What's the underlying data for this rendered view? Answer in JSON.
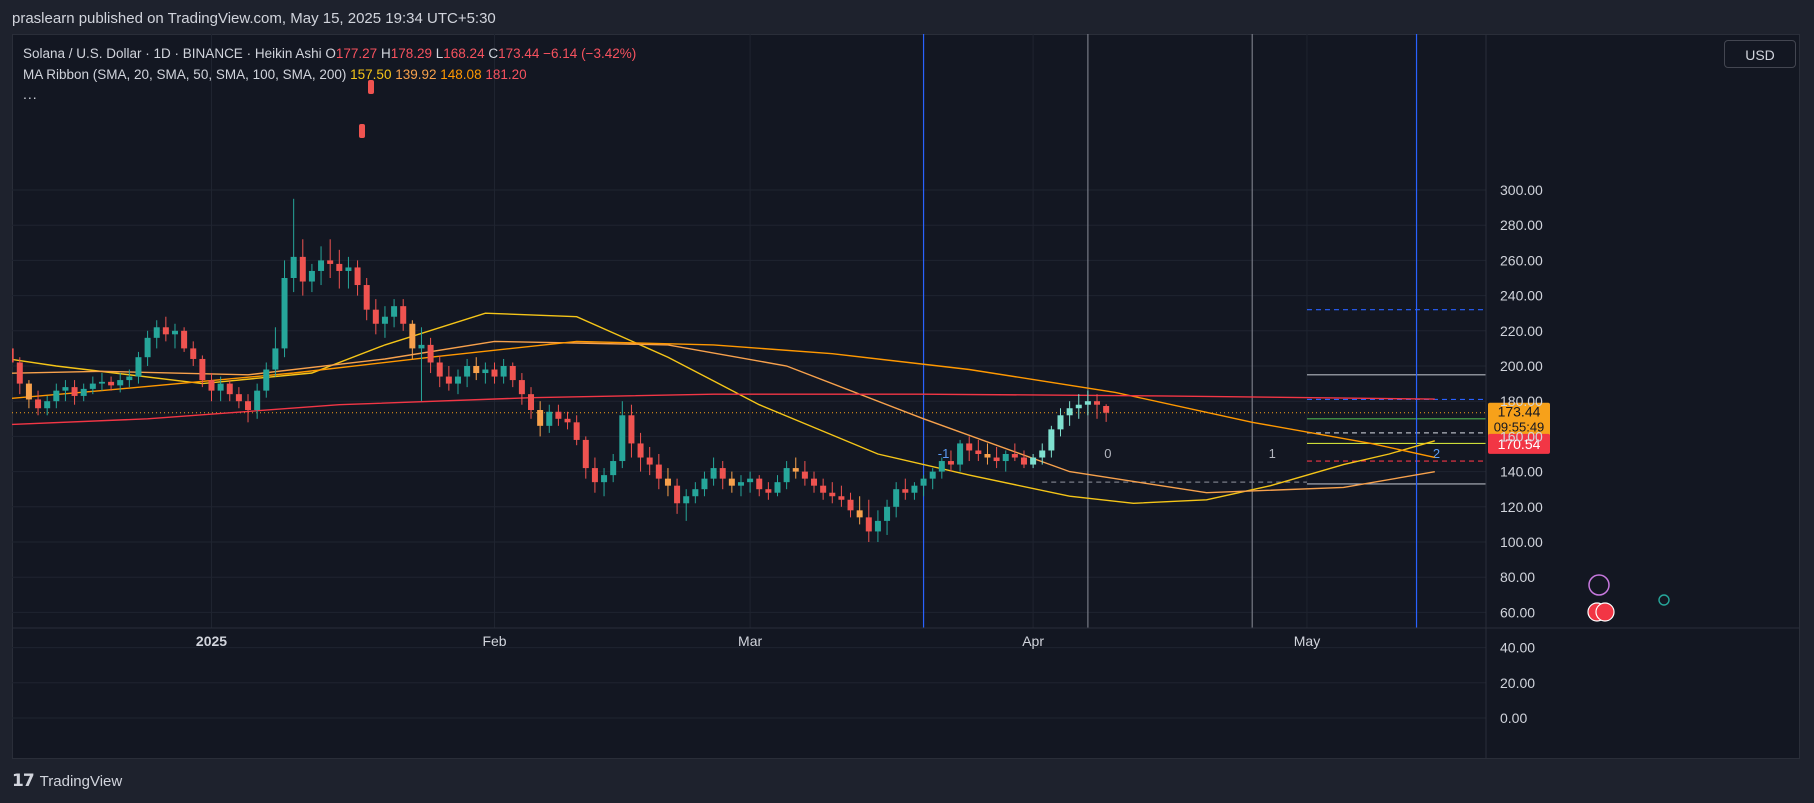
{
  "header": {
    "published": "praslearn published on TradingView.com, May 15, 2025 19:34 UTC+5:30"
  },
  "legend": {
    "symbol": "Solana / U.S. Dollar · 1D · BINANCE · Heikin Ashi",
    "o_label": "O",
    "o_value": "177.27",
    "h_label": "H",
    "h_value": "178.29",
    "l_label": "L",
    "l_value": "168.24",
    "c_label": "C",
    "c_value": "173.44",
    "change": "−6.14 (−3.42%)",
    "ma_label": "MA Ribbon (SMA, 20, SMA, 50, SMA, 100, SMA, 200)",
    "ma20": "157.50",
    "ma50": "139.92",
    "ma100": "148.08",
    "ma200": "181.20",
    "more": "..."
  },
  "currency": "USD",
  "price_badges": {
    "last": "173.44",
    "countdown": "09:55:49",
    "marker": "170.54"
  },
  "cycle_labels": [
    "-1",
    "0",
    "1",
    "2"
  ],
  "footer": {
    "brand": "TradingView"
  },
  "colors": {
    "up": "#26a69a",
    "down": "#ef5350",
    "ma20": "#f5c518",
    "ma50": "#f7a14c",
    "ma100": "#ff9800",
    "ma200": "#f23645",
    "cycle": "#2962ff",
    "badge_last": "#f7a11a",
    "badge_marker": "#f23645"
  },
  "chart_data": {
    "type": "candlestick",
    "x_ticks": [
      {
        "label": "2025",
        "date": "2025-01-01"
      },
      {
        "label": "Feb",
        "date": "2025-02-01"
      },
      {
        "label": "Mar",
        "date": "2025-03-01"
      },
      {
        "label": "Apr",
        "date": "2025-04-01"
      },
      {
        "label": "May",
        "date": "2025-05-01"
      }
    ],
    "y_ticks": [
      0,
      20,
      40,
      60,
      80,
      100,
      120,
      140,
      160,
      180,
      200,
      220,
      240,
      260,
      280,
      300
    ],
    "ylim": [
      0,
      300
    ],
    "candles_start": "2024-12-02",
    "candles": [
      [
        210,
        220,
        200,
        195
      ],
      [
        205,
        226,
        200,
        213
      ],
      [
        213,
        230,
        208,
        222
      ],
      [
        222,
        226,
        212,
        220
      ],
      [
        220,
        224,
        212,
        216
      ],
      [
        216,
        222,
        208,
        213
      ],
      [
        213,
        220,
        206,
        216
      ],
      [
        216,
        220,
        204,
        210
      ],
      [
        210,
        214,
        196,
        202
      ],
      [
        202,
        205,
        184,
        190
      ],
      [
        190,
        192,
        176,
        181
      ],
      [
        181,
        186,
        172,
        176
      ],
      [
        176,
        183,
        172,
        180
      ],
      [
        180,
        190,
        176,
        186
      ],
      [
        186,
        192,
        180,
        188
      ],
      [
        188,
        192,
        178,
        183
      ],
      [
        183,
        190,
        180,
        187
      ],
      [
        187,
        194,
        184,
        190
      ],
      [
        190,
        196,
        186,
        191
      ],
      [
        191,
        194,
        186,
        189
      ],
      [
        189,
        196,
        185,
        192
      ],
      [
        192,
        198,
        188,
        194
      ],
      [
        194,
        208,
        190,
        205
      ],
      [
        205,
        220,
        200,
        216
      ],
      [
        216,
        226,
        210,
        222
      ],
      [
        222,
        228,
        214,
        218
      ],
      [
        218,
        224,
        210,
        220
      ],
      [
        220,
        222,
        208,
        210
      ],
      [
        210,
        214,
        200,
        204
      ],
      [
        204,
        206,
        188,
        192
      ],
      [
        192,
        196,
        180,
        186
      ],
      [
        186,
        194,
        180,
        190
      ],
      [
        190,
        192,
        180,
        184
      ],
      [
        184,
        188,
        176,
        180
      ],
      [
        180,
        184,
        168,
        175
      ],
      [
        175,
        190,
        170,
        186
      ],
      [
        186,
        202,
        182,
        198
      ],
      [
        198,
        222,
        194,
        210
      ],
      [
        210,
        260,
        205,
        250
      ],
      [
        250,
        295,
        242,
        262
      ],
      [
        262,
        272,
        240,
        248
      ],
      [
        248,
        258,
        242,
        254
      ],
      [
        254,
        268,
        246,
        260
      ],
      [
        260,
        272,
        250,
        258
      ],
      [
        258,
        266,
        244,
        254
      ],
      [
        254,
        262,
        244,
        256
      ],
      [
        256,
        260,
        240,
        246
      ],
      [
        246,
        250,
        226,
        232
      ],
      [
        232,
        238,
        218,
        224
      ],
      [
        224,
        234,
        216,
        228
      ],
      [
        228,
        238,
        222,
        234
      ],
      [
        234,
        238,
        220,
        224
      ],
      [
        224,
        226,
        204,
        210
      ],
      [
        210,
        222,
        180,
        212
      ],
      [
        212,
        216,
        196,
        202
      ],
      [
        202,
        206,
        188,
        194
      ],
      [
        194,
        200,
        186,
        190
      ],
      [
        190,
        198,
        184,
        194
      ],
      [
        194,
        204,
        188,
        200
      ],
      [
        200,
        205,
        192,
        196
      ],
      [
        196,
        202,
        190,
        198
      ],
      [
        198,
        202,
        190,
        194
      ],
      [
        194,
        204,
        190,
        200
      ],
      [
        200,
        202,
        188,
        192
      ],
      [
        192,
        196,
        178,
        184
      ],
      [
        184,
        188,
        170,
        175
      ],
      [
        175,
        180,
        160,
        166
      ],
      [
        166,
        178,
        162,
        174
      ],
      [
        174,
        178,
        166,
        170
      ],
      [
        170,
        174,
        164,
        168
      ],
      [
        168,
        172,
        155,
        158
      ],
      [
        158,
        160,
        136,
        142
      ],
      [
        142,
        148,
        128,
        134
      ],
      [
        134,
        142,
        126,
        138
      ],
      [
        138,
        150,
        134,
        146
      ],
      [
        146,
        180,
        142,
        172
      ],
      [
        172,
        178,
        148,
        156
      ],
      [
        156,
        162,
        140,
        148
      ],
      [
        148,
        154,
        138,
        144
      ],
      [
        144,
        150,
        130,
        136
      ],
      [
        136,
        142,
        126,
        132
      ],
      [
        132,
        136,
        116,
        122
      ],
      [
        122,
        130,
        112,
        126
      ],
      [
        126,
        134,
        122,
        130
      ],
      [
        130,
        140,
        126,
        136
      ],
      [
        136,
        148,
        132,
        142
      ],
      [
        142,
        146,
        130,
        136
      ],
      [
        136,
        140,
        128,
        132
      ],
      [
        132,
        138,
        126,
        134
      ],
      [
        134,
        140,
        128,
        136
      ],
      [
        136,
        138,
        126,
        130
      ],
      [
        130,
        134,
        124,
        128
      ],
      [
        128,
        138,
        126,
        134
      ],
      [
        134,
        146,
        130,
        142
      ],
      [
        142,
        148,
        136,
        140
      ],
      [
        140,
        146,
        132,
        136
      ],
      [
        136,
        140,
        128,
        132
      ],
      [
        132,
        136,
        124,
        128
      ],
      [
        128,
        134,
        122,
        126
      ],
      [
        126,
        132,
        120,
        124
      ],
      [
        124,
        128,
        114,
        118
      ],
      [
        118,
        126,
        110,
        114
      ],
      [
        114,
        124,
        100,
        106
      ],
      [
        106,
        118,
        100,
        112
      ],
      [
        112,
        124,
        104,
        120
      ],
      [
        120,
        134,
        114,
        130
      ],
      [
        130,
        136,
        124,
        128
      ],
      [
        128,
        134,
        124,
        132
      ],
      [
        132,
        138,
        126,
        136
      ],
      [
        136,
        142,
        130,
        140
      ],
      [
        140,
        148,
        136,
        146
      ],
      [
        146,
        152,
        140,
        144
      ],
      [
        144,
        158,
        140,
        156
      ],
      [
        156,
        160,
        146,
        152
      ],
      [
        152,
        158,
        146,
        150
      ],
      [
        150,
        156,
        144,
        148
      ],
      [
        148,
        154,
        142,
        146
      ],
      [
        146,
        152,
        140,
        150
      ],
      [
        150,
        156,
        146,
        148
      ],
      [
        148,
        152,
        142,
        144
      ],
      [
        144,
        150,
        142,
        148
      ],
      [
        148,
        156,
        144,
        152
      ],
      [
        152,
        166,
        148,
        164
      ],
      [
        164,
        176,
        160,
        172
      ],
      [
        172,
        180,
        166,
        176
      ],
      [
        176,
        184,
        170,
        178
      ],
      [
        178,
        186,
        172,
        180
      ],
      [
        180,
        184,
        170,
        178
      ],
      [
        177.27,
        178.29,
        168.24,
        173.44
      ]
    ],
    "ma_series": [
      {
        "name": "SMA 20",
        "points": [
          [
            "2024-12-02",
            210
          ],
          [
            "2024-12-15",
            200
          ],
          [
            "2024-12-31",
            190
          ],
          [
            "2025-01-12",
            196
          ],
          [
            "2025-01-20",
            212
          ],
          [
            "2025-01-31",
            230
          ],
          [
            "2025-02-10",
            228
          ],
          [
            "2025-02-20",
            205
          ],
          [
            "2025-03-02",
            178
          ],
          [
            "2025-03-15",
            150
          ],
          [
            "2025-03-25",
            138
          ],
          [
            "2025-04-05",
            126
          ],
          [
            "2025-04-12",
            122
          ],
          [
            "2025-04-20",
            124
          ],
          [
            "2025-04-27",
            132
          ],
          [
            "2025-05-05",
            144
          ],
          [
            "2025-05-10",
            150
          ],
          [
            "2025-05-15",
            157.5
          ]
        ]
      },
      {
        "name": "SMA 50",
        "points": [
          [
            "2024-12-02",
            195
          ],
          [
            "2024-12-20",
            197
          ],
          [
            "2025-01-05",
            195
          ],
          [
            "2025-01-20",
            204
          ],
          [
            "2025-02-01",
            214
          ],
          [
            "2025-02-20",
            212
          ],
          [
            "2025-03-05",
            200
          ],
          [
            "2025-03-20",
            170
          ],
          [
            "2025-04-05",
            140
          ],
          [
            "2025-04-20",
            128
          ],
          [
            "2025-05-05",
            131
          ],
          [
            "2025-05-15",
            139.92
          ]
        ]
      },
      {
        "name": "SMA 100",
        "points": [
          [
            "2024-12-02",
            178
          ],
          [
            "2024-12-20",
            186
          ],
          [
            "2025-01-10",
            196
          ],
          [
            "2025-01-25",
            205
          ],
          [
            "2025-02-10",
            214
          ],
          [
            "2025-02-25",
            212
          ],
          [
            "2025-03-10",
            207
          ],
          [
            "2025-03-25",
            198
          ],
          [
            "2025-04-10",
            185
          ],
          [
            "2025-04-25",
            168
          ],
          [
            "2025-05-08",
            156
          ],
          [
            "2025-05-15",
            148.08
          ]
        ]
      },
      {
        "name": "SMA 200",
        "points": [
          [
            "2024-12-02",
            165
          ],
          [
            "2024-12-25",
            170
          ],
          [
            "2025-01-15",
            178
          ],
          [
            "2025-02-05",
            182
          ],
          [
            "2025-02-25",
            184
          ],
          [
            "2025-03-20",
            184
          ],
          [
            "2025-04-15",
            183
          ],
          [
            "2025-05-15",
            181.2
          ]
        ]
      }
    ],
    "last_price": 173.44,
    "marker_price": 170.54,
    "cycle_lines": [
      {
        "label": "-1",
        "date": "2025-03-20"
      },
      {
        "label": "0",
        "date": "2025-04-07"
      },
      {
        "label": "1",
        "date": "2025-04-25"
      },
      {
        "label": "2",
        "date": "2025-05-13"
      }
    ],
    "levels": [
      {
        "value": 232,
        "style": "dashed",
        "color": "#2962ff",
        "from": "2025-05-01"
      },
      {
        "value": 195,
        "style": "solid",
        "color": "#b2b5be",
        "from": "2025-05-01"
      },
      {
        "value": 181,
        "style": "dashed",
        "color": "#2962ff",
        "from": "2025-05-01"
      },
      {
        "value": 170,
        "style": "solid",
        "color": "#4caf50",
        "from": "2025-05-01"
      },
      {
        "value": 162,
        "style": "dashed",
        "color": "#b2b5be",
        "from": "2025-05-01"
      },
      {
        "value": 156,
        "style": "solid",
        "color": "#cddc39",
        "from": "2025-05-01"
      },
      {
        "value": 146,
        "style": "dashed",
        "color": "#f23645",
        "from": "2025-05-01"
      },
      {
        "value": 133,
        "style": "solid",
        "color": "#b2b5be",
        "from": "2025-05-01"
      },
      {
        "value": 134,
        "style": "dashed",
        "color": "#787b86",
        "from": "2025-04-02",
        "to": "2025-05-01"
      }
    ]
  }
}
